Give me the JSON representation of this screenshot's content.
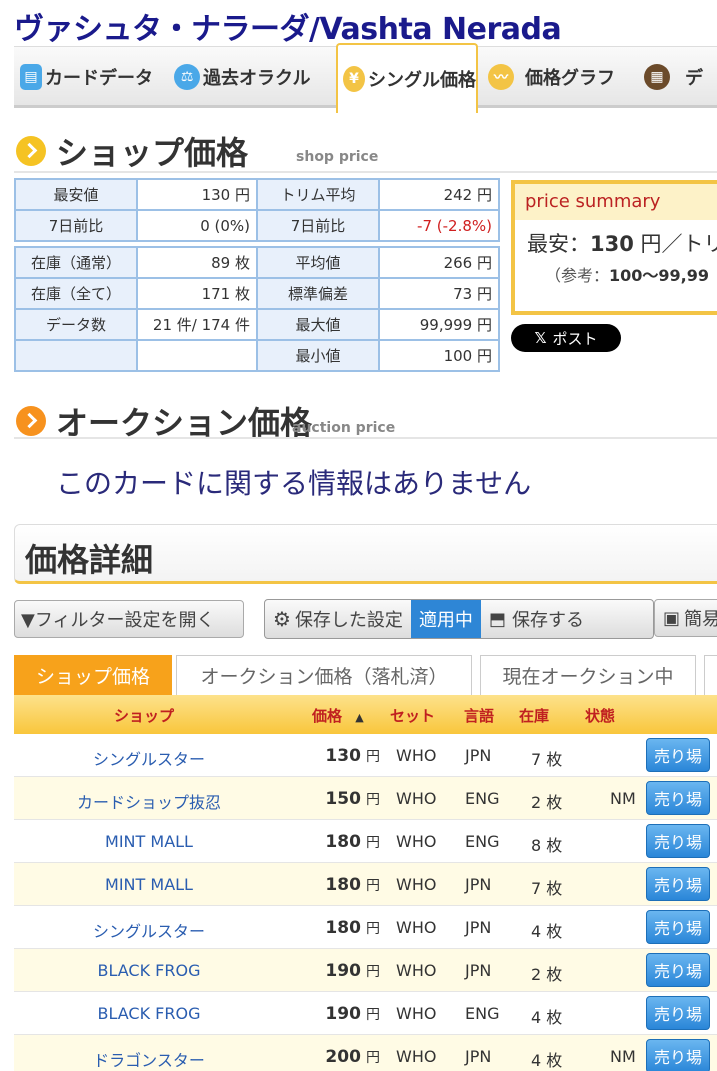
{
  "title": "ヴァシュタ・ナラーダ/Vashta Nerada",
  "nav_tabs": [
    {
      "label": "カードデータ",
      "icon": "card-icon"
    },
    {
      "label": "過去オラクル",
      "icon": "scale-icon"
    },
    {
      "label": "シングル価格",
      "icon": "yen-icon"
    },
    {
      "label": "価格グラフ",
      "icon": "graph-icon"
    },
    {
      "label": "デ",
      "icon": "grid-icon"
    }
  ],
  "shop_price": {
    "heading": "ショップ価格",
    "heading_en": "shop price",
    "rows": [
      {
        "k1": "最安値",
        "v1": "130 円",
        "k2": "トリム平均",
        "v2": "242 円"
      },
      {
        "k1": "7日前比",
        "v1": "0 (0%)",
        "k2": "7日前比",
        "v2": "-7 (-2.8%)"
      },
      {
        "k1": "在庫（通常）",
        "v1": "89 枚",
        "k2": "平均値",
        "v2": "266 円"
      },
      {
        "k1": "在庫（全て）",
        "v1": "171 枚",
        "k2": "標準偏差",
        "v2": "73 円"
      },
      {
        "k1": "データ数",
        "v1": "21 件/ 174 件",
        "k2": "最大値",
        "v2": "99,999 円"
      },
      {
        "k1": "",
        "v1": "",
        "k2": "最小値",
        "v2": "100 円"
      }
    ]
  },
  "summary": {
    "title": "price summary",
    "line1_prefix": "最安：",
    "line1_value": "130",
    "line1_suffix": " 円／トリ",
    "line2_prefix": "（参考：",
    "line2_value": "100〜99,99"
  },
  "post_button": {
    "icon": "x-logo-icon",
    "label": "ポスト"
  },
  "auction": {
    "heading": "オークション価格",
    "heading_en": "auction price",
    "empty_message": "このカードに関する情報はありません"
  },
  "detail": {
    "heading": "価格詳細"
  },
  "toolbar": {
    "filter_label": "▼フィルター設定を開く",
    "saved_settings": "保存した設定",
    "applied": "適用中",
    "save": "保存する",
    "simple": "簡易"
  },
  "price_tabs": [
    "ショップ価格",
    "オークション価格（落札済）",
    "現在オークション中"
  ],
  "table": {
    "headers": {
      "shop": "ショップ",
      "price": "価格",
      "sort": "▲",
      "set": "セット",
      "lang": "言語",
      "stock": "在庫",
      "cond": "状態"
    },
    "sell_label": "売り場",
    "yen": "円",
    "rows": [
      {
        "shop": "シングルスター",
        "price": "130",
        "set": "WHO",
        "lang": "JPN",
        "stock": "7 枚",
        "cond": ""
      },
      {
        "shop": "カードショップ抜忍",
        "price": "150",
        "set": "WHO",
        "lang": "ENG",
        "stock": "2 枚",
        "cond": "NM"
      },
      {
        "shop": "MINT MALL",
        "price": "180",
        "set": "WHO",
        "lang": "ENG",
        "stock": "8 枚",
        "cond": ""
      },
      {
        "shop": "MINT MALL",
        "price": "180",
        "set": "WHO",
        "lang": "JPN",
        "stock": "7 枚",
        "cond": ""
      },
      {
        "shop": "シングルスター",
        "price": "180",
        "set": "WHO",
        "lang": "JPN",
        "stock": "4 枚",
        "cond": ""
      },
      {
        "shop": "BLACK FROG",
        "price": "190",
        "set": "WHO",
        "lang": "JPN",
        "stock": "2 枚",
        "cond": ""
      },
      {
        "shop": "BLACK FROG",
        "price": "190",
        "set": "WHO",
        "lang": "ENG",
        "stock": "4 枚",
        "cond": ""
      },
      {
        "shop": "ドラゴンスター",
        "price": "200",
        "set": "WHO",
        "lang": "JPN",
        "stock": "4 枚",
        "cond": "NM"
      }
    ]
  },
  "colors": {
    "accent": "#f3c445",
    "brand_title": "#1a1a8c",
    "orange_tab": "#f7a21b",
    "blue_button": "#2a86d8",
    "negative": "#d02020"
  }
}
